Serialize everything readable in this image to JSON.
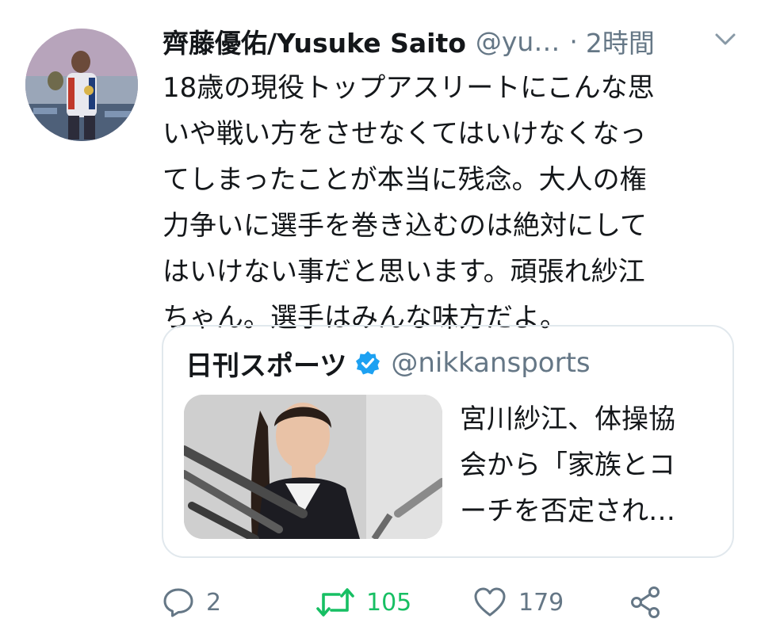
{
  "author": {
    "name": "齊藤優佑/Yusuke Saito",
    "handle": "@yu…",
    "separator": "·",
    "time": "2時間"
  },
  "tweet": {
    "text": "18歳の現役トップアスリートにこんな思\nいや戦い方をさせなくてはいけなくなっ\nてしまったことが本当に残念。大人の権\n力争いに選手を巻き込むのは絶対にして\nはいけない事だと思います。頑張れ紗江\nちゃん。選手はみんな味方だよ。"
  },
  "quoted": {
    "name": "日刊スポーツ",
    "handle": "@nikkansports",
    "title": "宮川紗江、体操協\n会から「家族とコ\nーチを否定され…"
  },
  "actions": {
    "reply_count": "2",
    "retweet_count": "105",
    "like_count": "179"
  },
  "icons": {
    "header_menu": "chevron-down-icon",
    "verified": "verified-badge-icon",
    "reply": "reply-icon",
    "retweet": "retweet-icon",
    "like": "heart-icon",
    "share": "share-icon"
  },
  "colors": {
    "text": "#14171a",
    "secondary": "#657786",
    "retweet_active": "#17bf63",
    "verified": "#1da1f2",
    "card_border": "#e1e8ed"
  }
}
